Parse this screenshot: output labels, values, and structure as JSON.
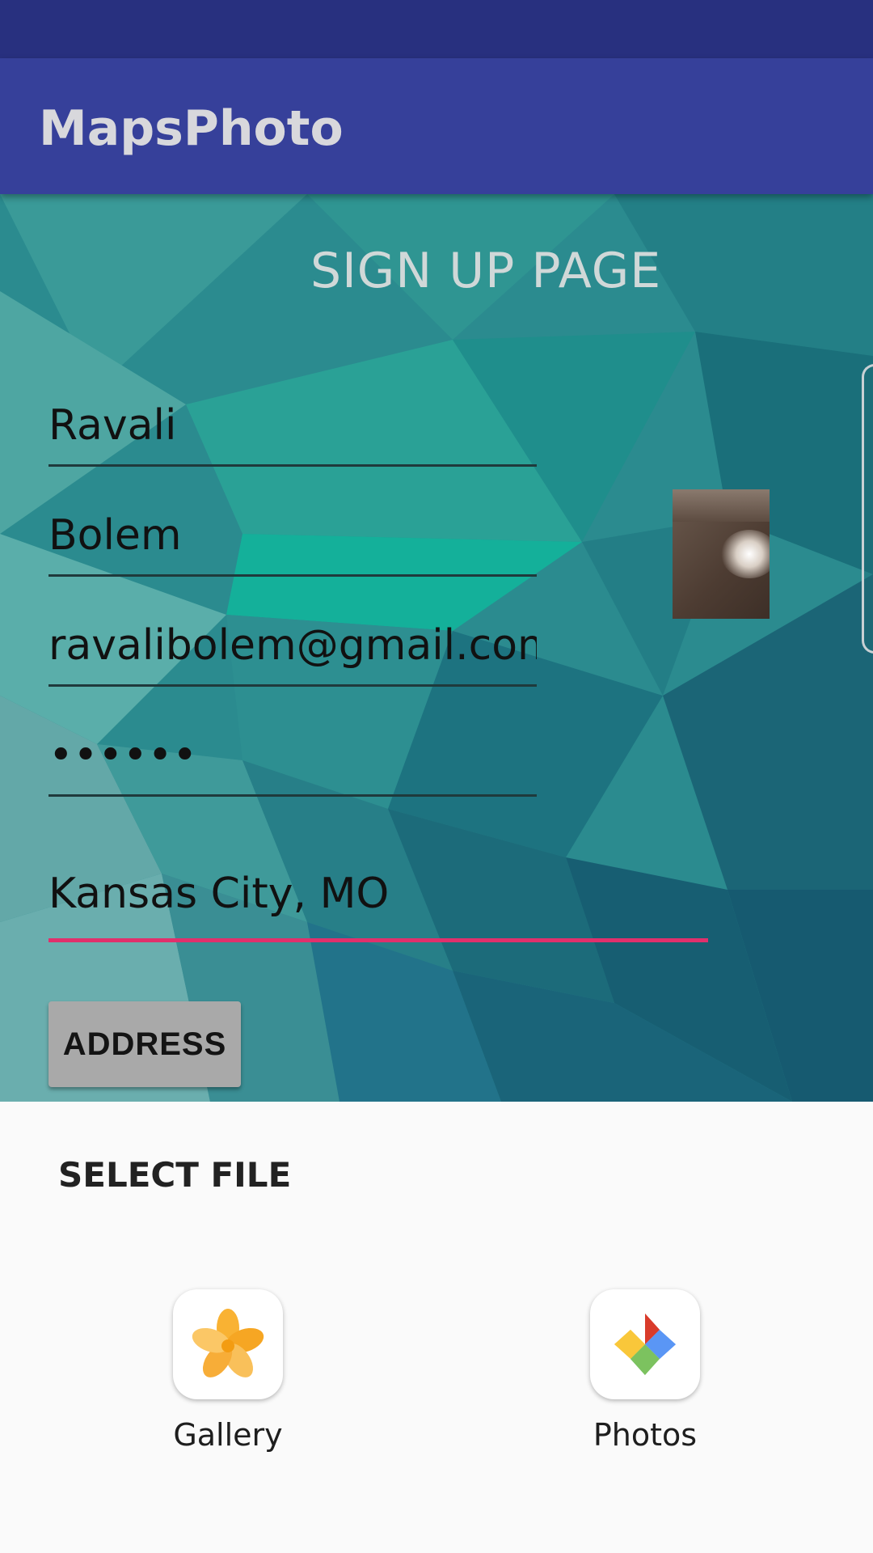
{
  "app_bar": {
    "title": "MapsPhoto"
  },
  "form": {
    "heading": "SIGN UP PAGE",
    "first_name": "Ravali",
    "last_name": "Bolem",
    "email": "ravalibolem@gmail.com",
    "password": "••••••",
    "location": "Kansas City, MO",
    "address_button": "ADDRESS"
  },
  "sheet": {
    "title": "SELECT FILE",
    "apps": [
      {
        "label": "Gallery",
        "icon": "gallery-icon"
      },
      {
        "label": "Photos",
        "icon": "photos-icon"
      }
    ]
  },
  "colors": {
    "status_bar": "#28307f",
    "app_bar": "#36409a",
    "accent": "#e0306c",
    "content_bg": "#2b8b8f"
  }
}
